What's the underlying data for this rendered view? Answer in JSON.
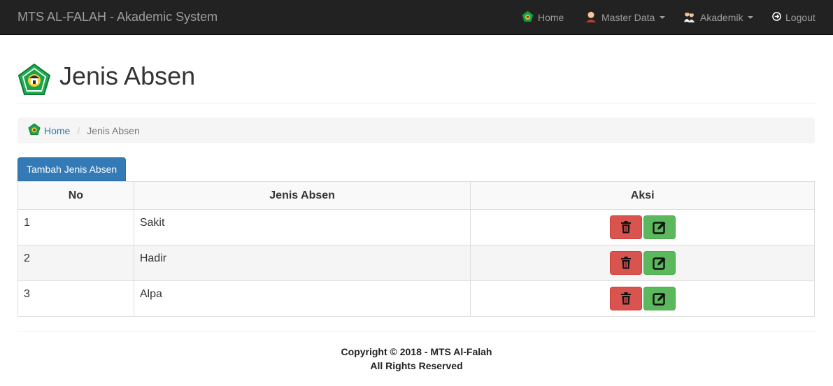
{
  "navbar": {
    "brand": "MTS AL-FALAH - Akademic System",
    "items": [
      {
        "label": "Home",
        "icon": "school-logo-icon"
      },
      {
        "label": "Master Data",
        "icon": "user-avatar-icon"
      },
      {
        "label": "Akademik",
        "icon": "students-icon"
      },
      {
        "label": "Logout",
        "icon": "logout-icon"
      }
    ]
  },
  "header": {
    "title": "Jenis Absen",
    "logo_icon": "school-logo-icon"
  },
  "breadcrumb": {
    "home": "Home",
    "separator": "/",
    "current": "Jenis Absen"
  },
  "actions": {
    "add_label": "Tambah Jenis Absen"
  },
  "table": {
    "columns": [
      "No",
      "Jenis Absen",
      "Aksi"
    ],
    "rows": [
      {
        "no": "1",
        "jenis": "Sakit"
      },
      {
        "no": "2",
        "jenis": "Hadir"
      },
      {
        "no": "3",
        "jenis": "Alpa"
      }
    ],
    "row_action_icons": [
      "trash-icon",
      "edit-icon"
    ]
  },
  "footer": {
    "line1": "Copyright © 2018 - MTS Al-Falah",
    "line2": "All Rights Reserved"
  },
  "colors": {
    "navbar_bg": "#222222",
    "link": "#337ab7",
    "primary": "#337ab7",
    "danger": "#d9534f",
    "success": "#5cb85c"
  }
}
